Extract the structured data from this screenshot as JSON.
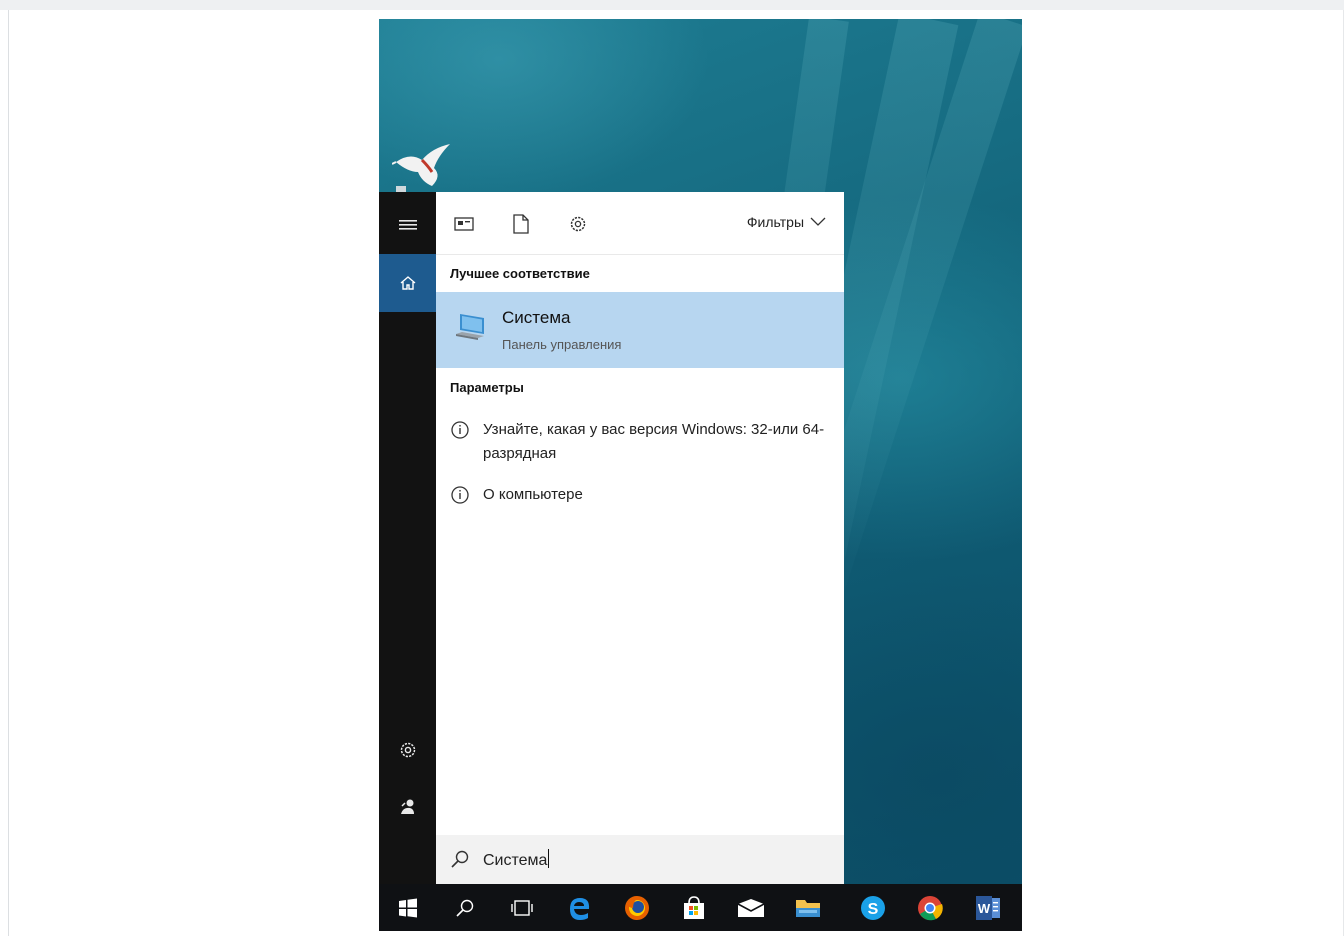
{
  "filters": {
    "label": "Фильтры"
  },
  "best_match": {
    "heading": "Лучшее соответствие",
    "title": "Система",
    "subtitle": "Панель управления"
  },
  "settings_section": {
    "heading": "Параметры",
    "items": [
      {
        "label": "Узнайте, какая у вас версия Windows: 32-или 64-разрядная"
      },
      {
        "label": "О компьютере"
      }
    ]
  },
  "search": {
    "value": "Система"
  },
  "colors": {
    "accent": "#1e5b8f",
    "selection": "#b7d6f0",
    "rail": "#121212",
    "taskbar": "#0f1114"
  },
  "icons": {
    "rail": [
      "hamburger-icon",
      "home-icon",
      "settings-gear-icon",
      "user-icon"
    ],
    "toolbar": [
      "apps-icon",
      "document-icon",
      "settings-icon"
    ],
    "taskbar": [
      "windows-start-icon",
      "search-icon",
      "task-view-icon",
      "edge-icon",
      "firefox-icon",
      "store-icon",
      "mail-icon",
      "file-explorer-icon",
      "skype-icon",
      "chrome-icon",
      "word-icon"
    ]
  }
}
